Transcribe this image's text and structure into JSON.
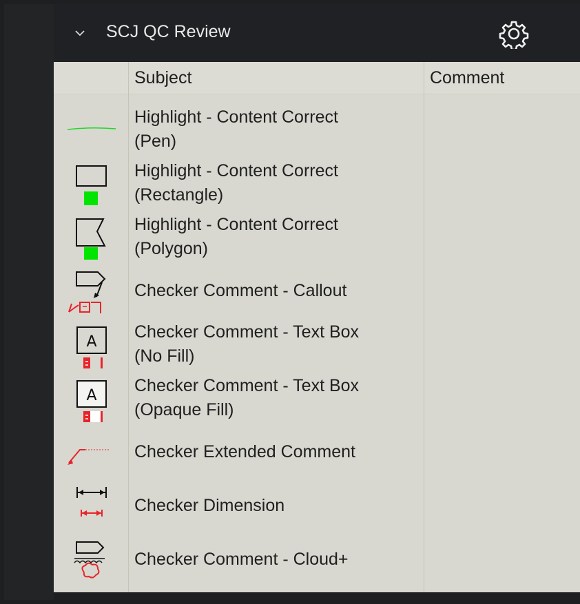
{
  "panel": {
    "title": "SCJ QC Review",
    "expand_icon": "chevron-down-icon",
    "settings_icon": "gear-icon"
  },
  "table": {
    "columns": [
      "Subject",
      "Comment"
    ],
    "rows": [
      {
        "subject": "Highlight - Content Correct\n(Pen)",
        "icon": "green-pen-line-icon",
        "comment": ""
      },
      {
        "subject": "Highlight - Content Correct\n(Rectangle)",
        "icon": "rectangle-highlight-icon",
        "comment": ""
      },
      {
        "subject": "Highlight - Content Correct\n(Polygon)",
        "icon": "polygon-highlight-icon",
        "comment": ""
      },
      {
        "subject": "Checker Comment - Callout",
        "icon": "callout-icon",
        "comment": ""
      },
      {
        "subject": "Checker Comment - Text Box\n(No Fill)",
        "icon": "text-box-no-fill-icon",
        "comment": ""
      },
      {
        "subject": "Checker Comment - Text Box\n(Opaque Fill)",
        "icon": "text-box-opaque-fill-icon",
        "comment": ""
      },
      {
        "subject": "Checker Extended Comment",
        "icon": "extended-comment-icon",
        "comment": ""
      },
      {
        "subject": "Checker Dimension",
        "icon": "dimension-icon",
        "comment": ""
      },
      {
        "subject": "Checker Comment - Cloud+",
        "icon": "cloud-plus-icon",
        "comment": ""
      }
    ]
  },
  "colors": {
    "highlight_green": "#00e400",
    "checker_red": "#e8242a",
    "header_dark": "#202124",
    "panel_bg": "#d8d8d0"
  }
}
